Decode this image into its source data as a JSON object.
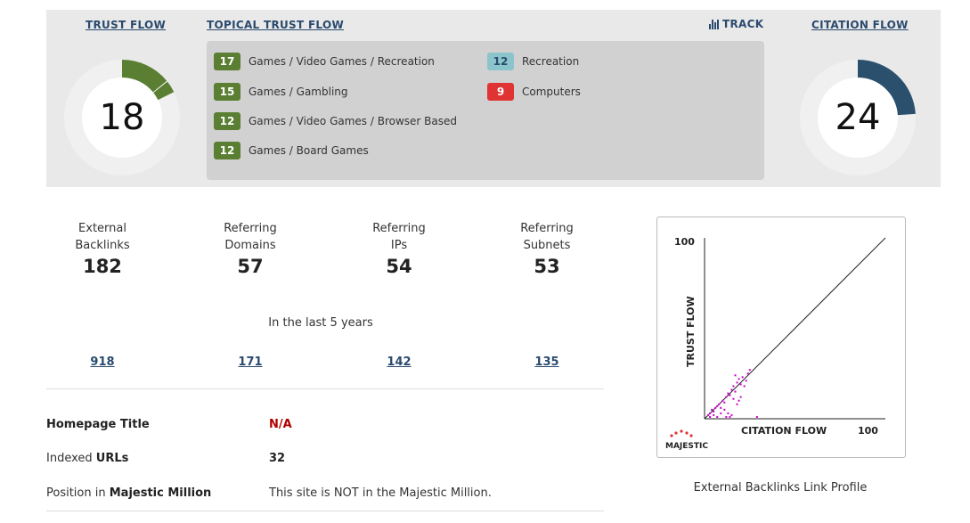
{
  "header": {
    "trust_flow_label": "TRUST FLOW",
    "topical_trust_flow_label": "TOPICAL TRUST FLOW",
    "track_label": "TRACK",
    "citation_flow_label": "CITATION FLOW"
  },
  "trust_flow": {
    "value": "18",
    "color": "#5a7f32"
  },
  "citation_flow": {
    "value": "24",
    "color": "#2b506e"
  },
  "topics": [
    {
      "score": "17",
      "name": "Games / Video Games / Recreation",
      "color": "#5a7f32"
    },
    {
      "score": "15",
      "name": "Games / Gambling",
      "color": "#5a7f32"
    },
    {
      "score": "12",
      "name": "Games / Video Games / Browser Based",
      "color": "#5a7f32"
    },
    {
      "score": "12",
      "name": "Games / Board Games",
      "color": "#5a7f32"
    },
    {
      "score": "12",
      "name": "Recreation",
      "color": "#8cc4cc",
      "text_color": "#2a4a6e"
    },
    {
      "score": "9",
      "name": "Computers",
      "color": "#e03333"
    }
  ],
  "metrics": [
    {
      "label_line1": "External",
      "label_line2": "Backlinks",
      "value": "182",
      "historic": "918"
    },
    {
      "label_line1": "Referring",
      "label_line2": "Domains",
      "value": "57",
      "historic": "171"
    },
    {
      "label_line1": "Referring",
      "label_line2": "IPs",
      "value": "54",
      "historic": "142"
    },
    {
      "label_line1": "Referring",
      "label_line2": "Subnets",
      "value": "53",
      "historic": "135"
    }
  ],
  "history_note": "In the last 5 years",
  "info": {
    "homepage_title_label": "Homepage Title",
    "homepage_title_value": "N/A",
    "indexed_label_plain": "Indexed ",
    "indexed_label_bold": "URLs",
    "indexed_value": "32",
    "position_label_plain": "Position in ",
    "position_label_bold": "Majestic Million",
    "position_value": "This site is NOT in the Majestic Million."
  },
  "chart_data": {
    "type": "scatter",
    "title": "",
    "xlabel": "CITATION FLOW",
    "ylabel": "TRUST FLOW",
    "xlim": [
      0,
      100
    ],
    "ylim": [
      0,
      100
    ],
    "x_max_label": "100",
    "y_max_label": "100",
    "diagonal": true,
    "points": [
      {
        "x": 2,
        "y": 2
      },
      {
        "x": 3,
        "y": 3
      },
      {
        "x": 4,
        "y": 5
      },
      {
        "x": 5,
        "y": 4
      },
      {
        "x": 6,
        "y": 6
      },
      {
        "x": 7,
        "y": 7
      },
      {
        "x": 8,
        "y": 8
      },
      {
        "x": 9,
        "y": 6
      },
      {
        "x": 10,
        "y": 10
      },
      {
        "x": 11,
        "y": 9
      },
      {
        "x": 12,
        "y": 12
      },
      {
        "x": 13,
        "y": 14
      },
      {
        "x": 14,
        "y": 13
      },
      {
        "x": 15,
        "y": 16
      },
      {
        "x": 16,
        "y": 18
      },
      {
        "x": 17,
        "y": 15
      },
      {
        "x": 18,
        "y": 20
      },
      {
        "x": 19,
        "y": 22
      },
      {
        "x": 17,
        "y": 24
      },
      {
        "x": 20,
        "y": 19
      },
      {
        "x": 15,
        "y": 2
      },
      {
        "x": 14,
        "y": 1
      },
      {
        "x": 13,
        "y": 3
      },
      {
        "x": 12,
        "y": 1
      },
      {
        "x": 18,
        "y": 8
      },
      {
        "x": 19,
        "y": 10
      },
      {
        "x": 20,
        "y": 12
      },
      {
        "x": 22,
        "y": 18
      },
      {
        "x": 23,
        "y": 21
      },
      {
        "x": 21,
        "y": 23
      },
      {
        "x": 29,
        "y": 1
      },
      {
        "x": 9,
        "y": 3
      },
      {
        "x": 7,
        "y": 1
      },
      {
        "x": 5,
        "y": 2
      },
      {
        "x": 16,
        "y": 11
      },
      {
        "x": 24,
        "y": 25
      },
      {
        "x": 25,
        "y": 27
      },
      {
        "x": 11,
        "y": 5
      },
      {
        "x": 3,
        "y": 1
      }
    ],
    "point_color": "#cc00cc",
    "brand_label": "MAJESTIC"
  },
  "plot_caption": "External Backlinks Link Profile"
}
